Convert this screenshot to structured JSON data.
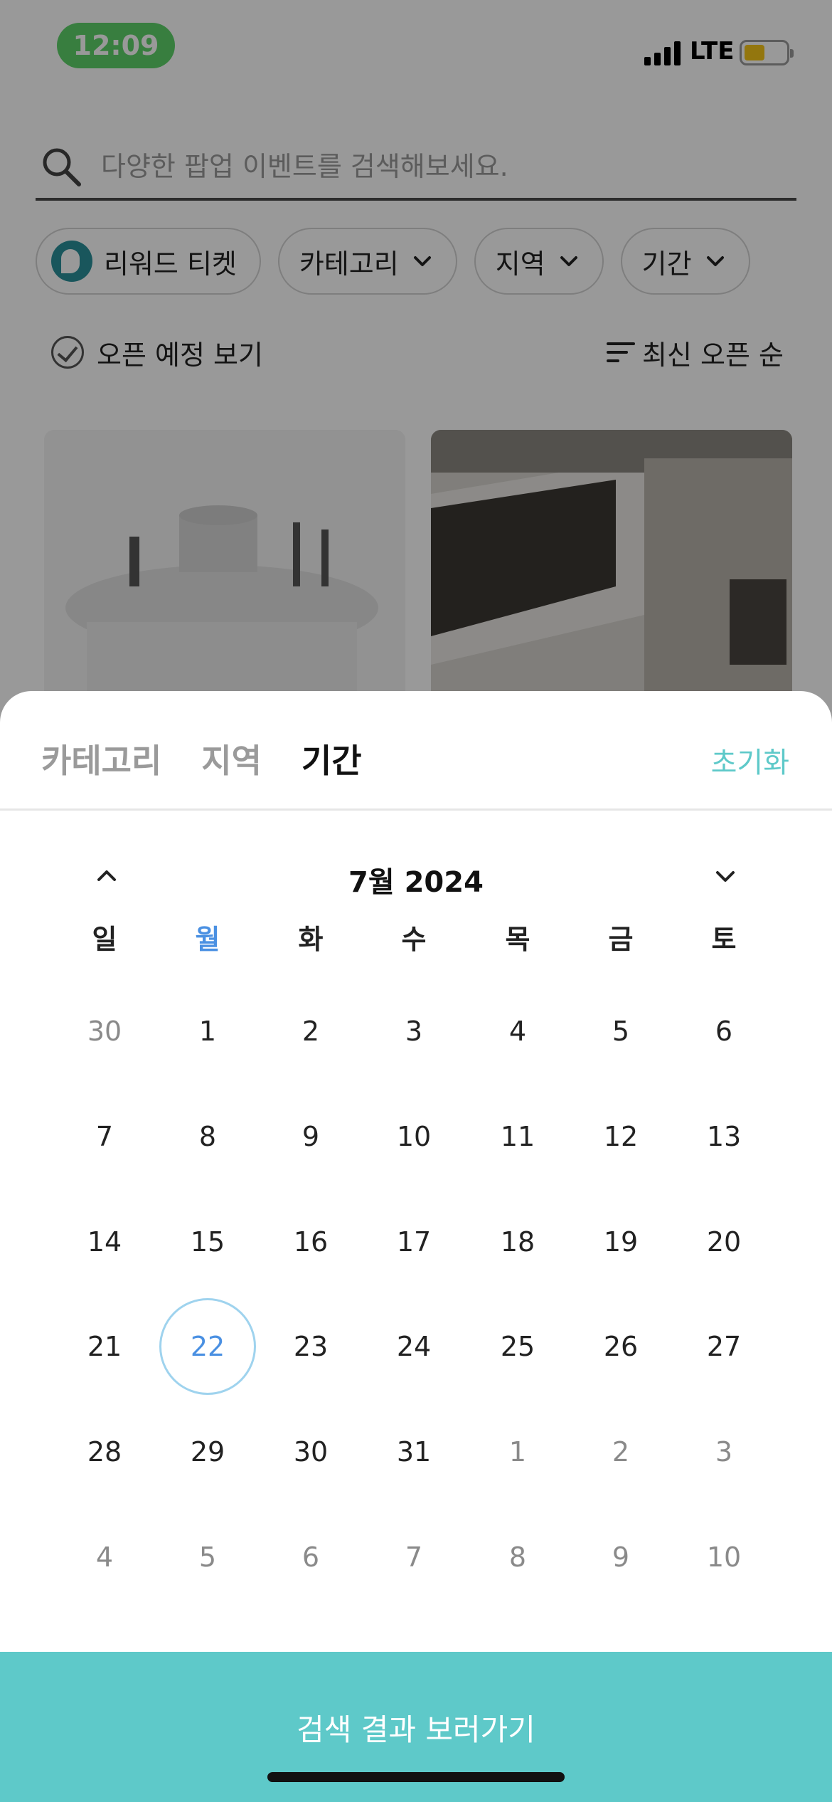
{
  "status_bar": {
    "time": "12:09",
    "network": "LTE"
  },
  "search": {
    "placeholder": "다양한 팝업 이벤트를 검색해보세요."
  },
  "chips": [
    {
      "label": "리워드 티켓"
    },
    {
      "label": "카테고리"
    },
    {
      "label": "지역"
    },
    {
      "label": "기간"
    }
  ],
  "filters": {
    "open_label": "오픈 예정 보기",
    "sort_label": "최신 오픈 순"
  },
  "sheet": {
    "tabs": [
      {
        "label": "카테고리",
        "active": false
      },
      {
        "label": "지역",
        "active": false
      },
      {
        "label": "기간",
        "active": true
      }
    ],
    "reset_label": "초기화"
  },
  "calendar": {
    "month_title": "7월 2024",
    "weekdays": [
      "일",
      "월",
      "화",
      "수",
      "목",
      "금",
      "토"
    ],
    "highlight_weekday_index": 1,
    "today": 22,
    "weeks": [
      [
        {
          "d": "30",
          "other": true
        },
        {
          "d": "1"
        },
        {
          "d": "2"
        },
        {
          "d": "3"
        },
        {
          "d": "4"
        },
        {
          "d": "5"
        },
        {
          "d": "6"
        }
      ],
      [
        {
          "d": "7"
        },
        {
          "d": "8"
        },
        {
          "d": "9"
        },
        {
          "d": "10"
        },
        {
          "d": "11"
        },
        {
          "d": "12"
        },
        {
          "d": "13"
        }
      ],
      [
        {
          "d": "14"
        },
        {
          "d": "15"
        },
        {
          "d": "16"
        },
        {
          "d": "17"
        },
        {
          "d": "18"
        },
        {
          "d": "19"
        },
        {
          "d": "20"
        }
      ],
      [
        {
          "d": "21"
        },
        {
          "d": "22",
          "today": true
        },
        {
          "d": "23"
        },
        {
          "d": "24"
        },
        {
          "d": "25"
        },
        {
          "d": "26"
        },
        {
          "d": "27"
        }
      ],
      [
        {
          "d": "28"
        },
        {
          "d": "29"
        },
        {
          "d": "30"
        },
        {
          "d": "31"
        },
        {
          "d": "1",
          "other": true
        },
        {
          "d": "2",
          "other": true
        },
        {
          "d": "3",
          "other": true
        }
      ],
      [
        {
          "d": "4",
          "other": true
        },
        {
          "d": "5",
          "other": true
        },
        {
          "d": "6",
          "other": true
        },
        {
          "d": "7",
          "other": true
        },
        {
          "d": "8",
          "other": true
        },
        {
          "d": "9",
          "other": true
        },
        {
          "d": "10",
          "other": true
        }
      ]
    ]
  },
  "cta": {
    "label": "검색 결과 보러가기"
  },
  "colors": {
    "accent": "#5ec9c9",
    "today_blue": "#4a90e2",
    "time_green": "#5ed26a"
  }
}
